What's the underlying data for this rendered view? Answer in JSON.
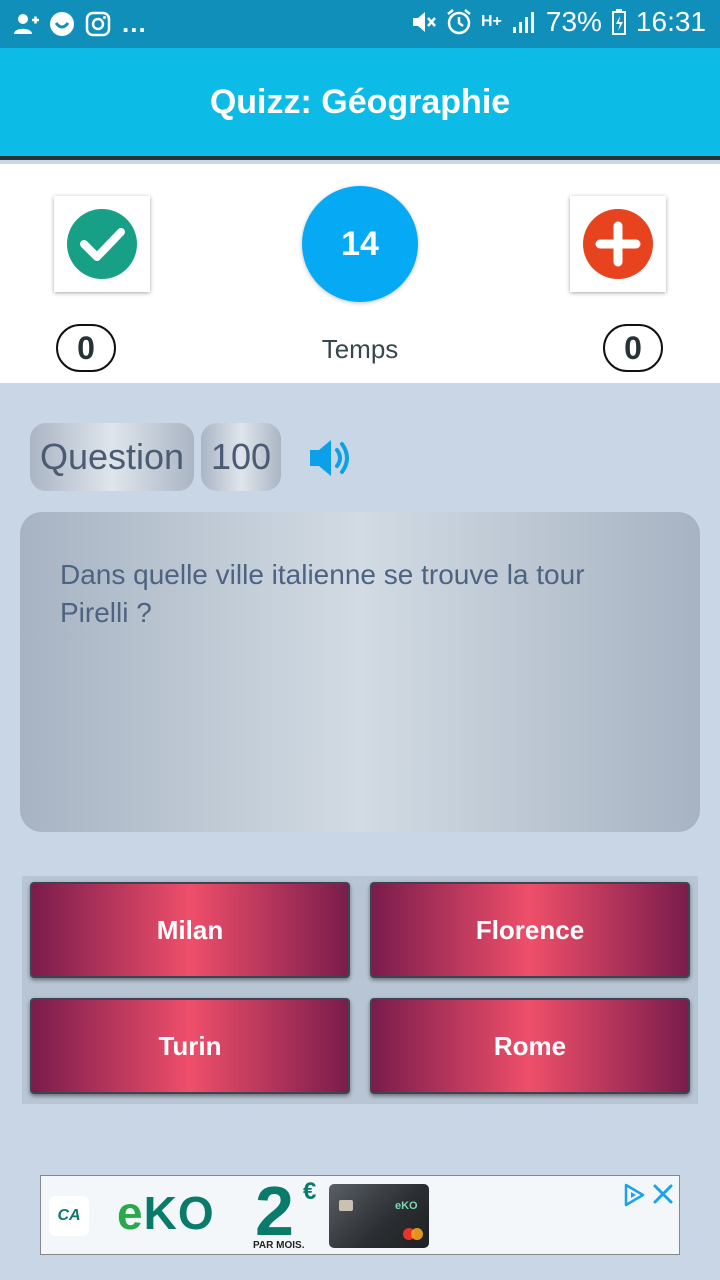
{
  "status_bar": {
    "dots": "...",
    "battery": "73%",
    "time": "16:31",
    "network": "H+",
    "icons_left": [
      "add-contact-icon",
      "smiley-icon",
      "instagram-icon"
    ],
    "icons_right": [
      "mute-icon",
      "alarm-icon",
      "signal-icon",
      "battery-charging-icon"
    ]
  },
  "app_bar": {
    "title": "Quizz: Géographie",
    "color": "#0cbce6"
  },
  "score": {
    "correct_count": "0",
    "timer_value": "14",
    "timer_label": "Temps",
    "bonus_count": "0",
    "correct_icon": "check-circle-icon",
    "bonus_icon": "plus-circle-icon",
    "correct_color": "#17a085",
    "bonus_color": "#e8431f",
    "timer_color": "#05a9f4"
  },
  "question": {
    "label": "Question",
    "number": "100",
    "text": "Dans quelle ville italienne se trouve la tour Pirelli ?",
    "sound_icon": "speaker-icon"
  },
  "answers": [
    {
      "label": "Milan"
    },
    {
      "label": "Florence"
    },
    {
      "label": "Turin"
    },
    {
      "label": "Rome"
    }
  ],
  "ad": {
    "logo": "CA",
    "brand_e": "e",
    "brand_ko": "KO",
    "price": "2",
    "currency": "€",
    "price_suffix": "PAR MOIS.",
    "card_brand": "eKO"
  }
}
